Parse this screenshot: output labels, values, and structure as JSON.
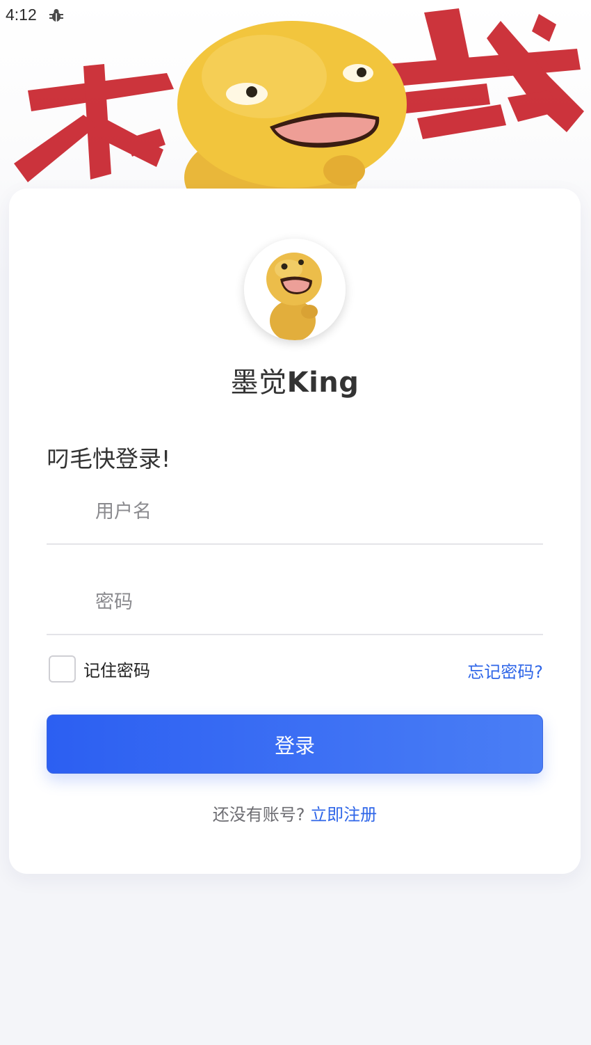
{
  "status_bar": {
    "time": "4:12",
    "icon": "bug-icon"
  },
  "banner": {
    "image": "mascot-banner-illustration",
    "colors": {
      "brush_red": "#c8232c",
      "mascot_yellow": "#f2c53d"
    }
  },
  "card": {
    "avatar": "mascot-avatar",
    "app_name_cjk": "墨觉",
    "app_name_latin": "King",
    "prompt": "叼毛快登录!",
    "username": {
      "placeholder": "用户名",
      "value": ""
    },
    "password": {
      "placeholder": "密码",
      "value": ""
    },
    "remember_label": "记住密码",
    "remember_checked": false,
    "forgot_label": "忘记密码?",
    "login_label": "登录",
    "register_question": "还没有账号?",
    "register_link": "立即注册"
  },
  "colors": {
    "accent": "#2f66e8",
    "button_start": "#2c5ff2",
    "button_end": "#4a7ef5",
    "background": "#f4f5f9"
  }
}
